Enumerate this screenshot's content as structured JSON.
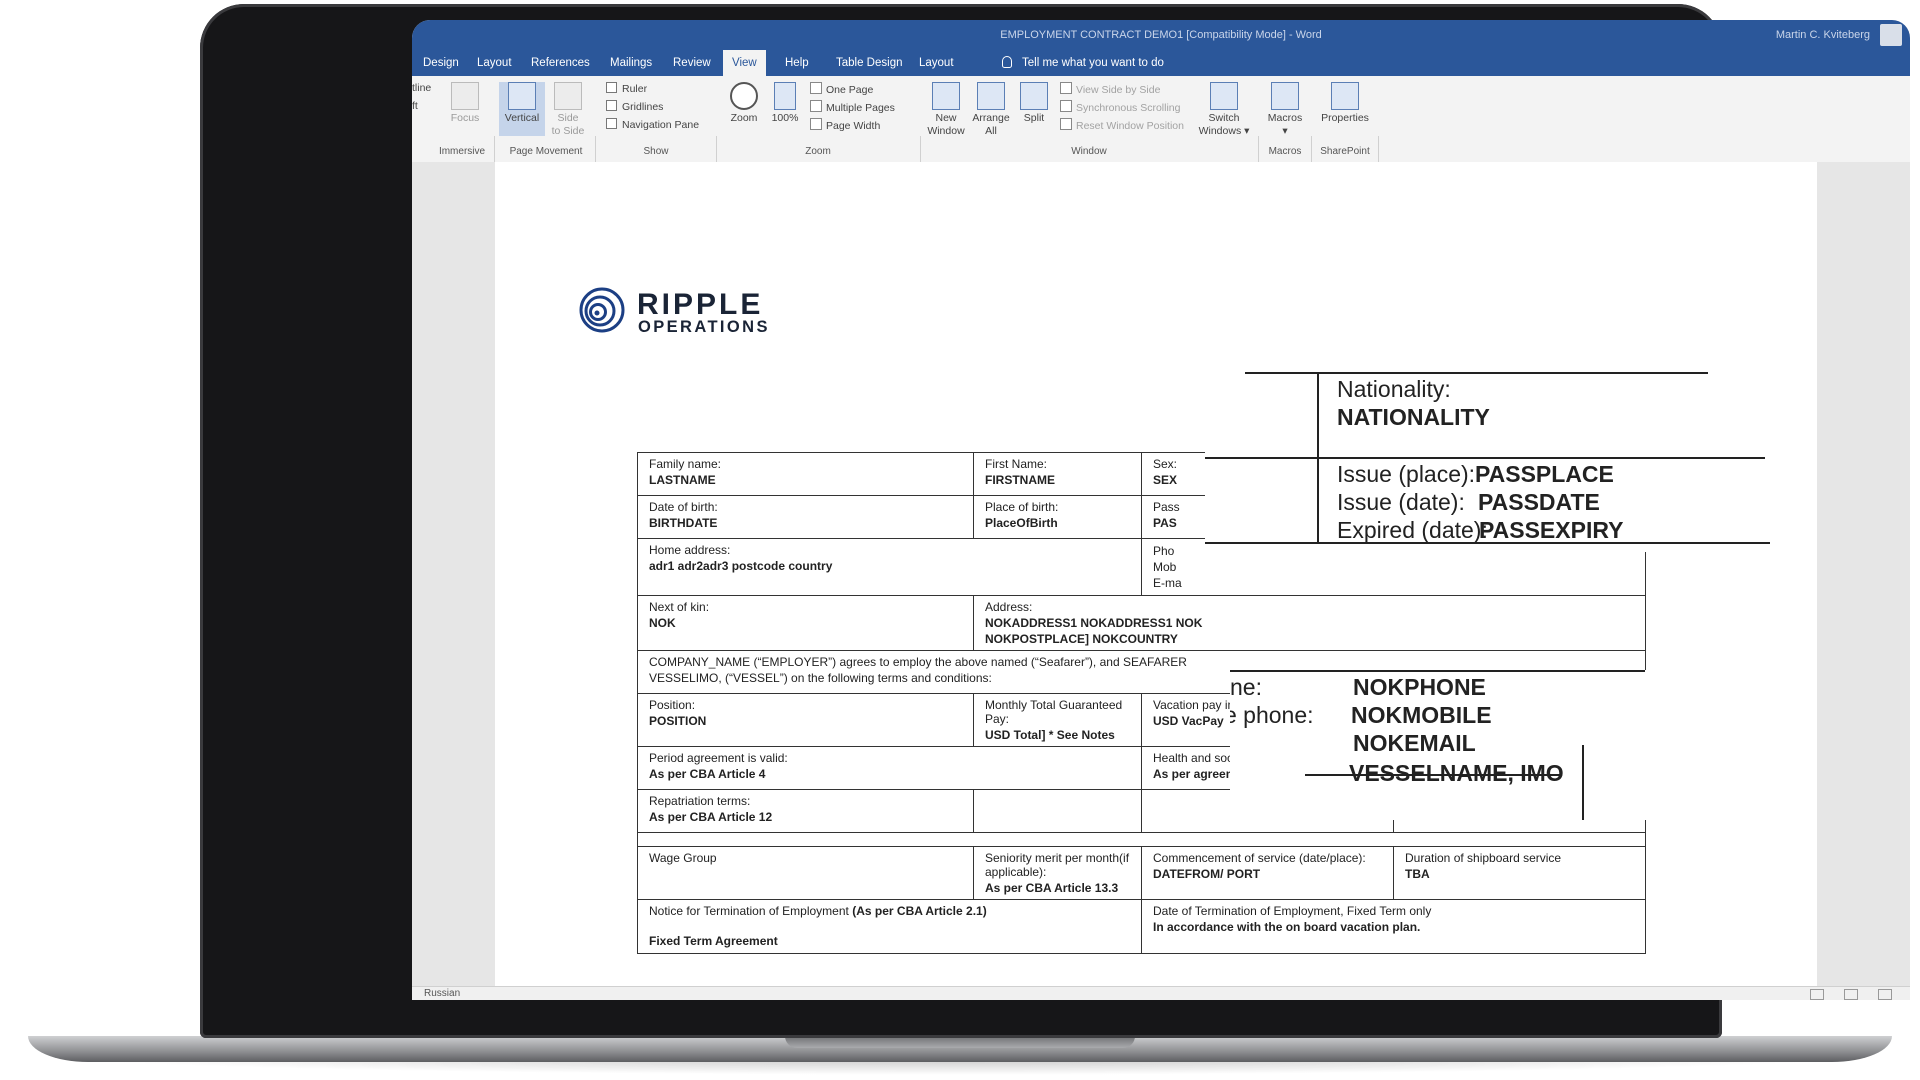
{
  "window": {
    "title": "EMPLOYMENT CONTRACT DEMO1 [Compatibility Mode] - Word",
    "user": "Martin C. Kviteberg"
  },
  "tabs": [
    {
      "label": "Design"
    },
    {
      "label": "Layout"
    },
    {
      "label": "References"
    },
    {
      "label": "Mailings"
    },
    {
      "label": "Review"
    },
    {
      "label": "View"
    },
    {
      "label": "Help"
    },
    {
      "label": "Table Design"
    },
    {
      "label": "Layout"
    }
  ],
  "tell_me": "Tell me what you want to do",
  "ribbon": {
    "clipped_top": "tline",
    "clipped_bottom": "ft",
    "focus": "Focus",
    "vertical": "Vertical",
    "side_to_side_1": "Side",
    "side_to_side_2": "to Side",
    "ruler": "Ruler",
    "gridlines": "Gridlines",
    "navigation_pane": "Navigation Pane",
    "zoom": "Zoom",
    "hundred": "100%",
    "one_page": "One Page",
    "multiple_pages": "Multiple Pages",
    "page_width": "Page Width",
    "new_window_1": "New",
    "new_window_2": "Window",
    "arrange_1": "Arrange",
    "arrange_2": "All",
    "split": "Split",
    "view_side_by_side": "View Side by Side",
    "sync_scrolling": "Synchronous Scrolling",
    "reset_window": "Reset Window Position",
    "switch_1": "Switch",
    "switch_2": "Windows ▾",
    "macros": "Macros",
    "properties": "Properties",
    "groups": {
      "immersive": "Immersive",
      "page_movement": "Page Movement",
      "show": "Show",
      "zoom": "Zoom",
      "window": "Window",
      "macros": "Macros",
      "sharepoint": "SharePoint"
    }
  },
  "logo": {
    "line1": "RIPPLE",
    "line2": "OPERATIONS"
  },
  "form": {
    "family_name_label": "Family name:",
    "family_name": "LASTNAME",
    "first_name_label": "First Name:",
    "first_name": "FIRSTNAME",
    "sex_label": "Sex:",
    "sex": "SEX",
    "dob_label": "Date of birth:",
    "dob": "BIRTHDATE",
    "pob_label": "Place of birth:",
    "pob": "PlaceOfBirth",
    "pass_label": "Pass",
    "pass": "PAS",
    "home_label": "Home address:",
    "home": "adr1 adr2adr3 postcode country",
    "pho": "Pho",
    "mob": "Mob",
    "email": "E-ma",
    "nok_label": "Next of kin:",
    "nok": "NOK",
    "address_label": "Address:",
    "nok_address_1": "NOKADDRESS1 NOKADDRESS1 NOK",
    "nok_address_2": "NOKPOSTPLACE] NOKCOUNTRY",
    "agreement_1": "COMPANY_NAME (“EMPLOYER”) agrees to employ the above named (“Seafarer”), and SEAFARER",
    "agreement_2": "VESSELIMO, (“VESSEL”) on the following terms and conditions:",
    "position_label": "Position:",
    "position": "POSITION",
    "pay_label": "Monthly Total Guaranteed Pay:",
    "pay": "USD Total] * See Notes",
    "vacation_label": "Vacation pay in",
    "vacation": "USD VacPay",
    "period_label": "Period agreement is valid:",
    "period": "As per CBA Article 4",
    "health_label": "Health and social security",
    "health": "As per agreement with UK Pa",
    "repat_label": "Repatriation terms:",
    "repat": "As per CBA Article 12",
    "wage_label": "Wage Group",
    "seniority_label": "Seniority merit per month(if applicable):",
    "seniority": "As per CBA Article 13.3",
    "commence_label": "Commencement of service (date/place):",
    "commence": "DATEFROM/ PORT",
    "duration_label": "Duration of shipboard service",
    "duration": "TBA",
    "notice_label": "Notice for Termination of Employment",
    "notice_ref": "(As per CBA Article 2.1)",
    "fixed_term": "Fixed Term Agreement",
    "termdate_label": "Date of Termination of Employment, Fixed Term only",
    "termdate": "In accordance with the on board vacation plan."
  },
  "zoom_overlay": {
    "nationality_label": "Nationality:",
    "nationality": "NATIONALITY",
    "issue_place_label": "Issue (place):",
    "issue_place": "PASSPLACE",
    "issue_date_label": "Issue (date):",
    "issue_date": "PASSDATE",
    "expired_label": "Expired (date):",
    "expired": "PASSEXPIRY",
    "phone_frag": "ne:",
    "phone": "NOKPHONE",
    "mobile_frag": "e phone:",
    "mobile": "NOKMOBILE",
    "email": "NOKEMAIL",
    "vessel": "VESSELNAME, IMO"
  },
  "status": {
    "language": "Russian"
  }
}
